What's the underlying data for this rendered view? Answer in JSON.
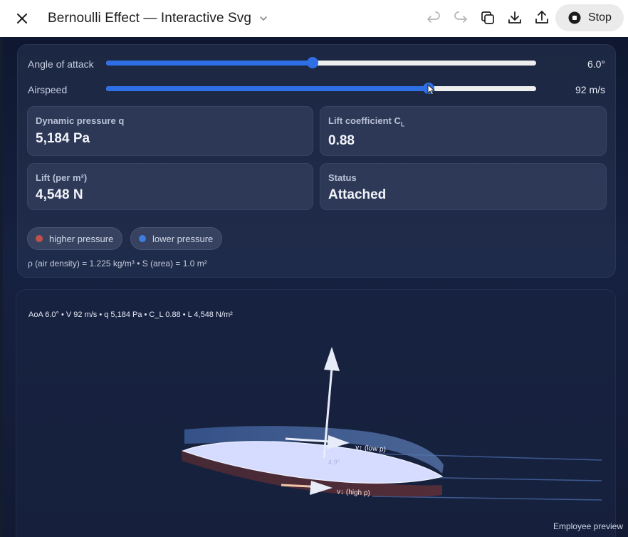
{
  "topbar": {
    "title": "Bernoulli Effect — Interactive Svg",
    "stop_label": "Stop",
    "icons": [
      "close-icon",
      "chevron-down-icon",
      "undo-icon",
      "redo-icon",
      "copy-icon",
      "download-icon",
      "share-icon",
      "stop-icon"
    ]
  },
  "controls": {
    "angle": {
      "label": "Angle of attack",
      "value_text": "6.0°",
      "fraction": 0.48
    },
    "airspeed": {
      "label": "Airspeed",
      "value_text": "92 m/s",
      "fraction": 0.75
    }
  },
  "stats": {
    "dynamic_pressure": {
      "label": "Dynamic pressure q",
      "value": "5,184 Pa"
    },
    "lift_coefficient": {
      "label": "Lift coefficient C",
      "label_sub": "L",
      "value": "0.88"
    },
    "lift": {
      "label": "Lift (per m²)",
      "value": "4,548 N"
    },
    "status": {
      "label": "Status",
      "value": "Attached"
    }
  },
  "legend": {
    "higher": {
      "label": "higher pressure",
      "color": "#c2504a"
    },
    "lower": {
      "label": "lower pressure",
      "color": "#3d7de0"
    }
  },
  "note": "ρ (air density) = 1.225 kg/m³ • S (area) = 1.0 m²",
  "viz": {
    "readout": "AoA 6.0° • V 92 m/s • q 5,184 Pa • C_L 0.88 • L 4,548 N/m²",
    "upper_label": "v↑ (low p)",
    "lower_label": "v↓ (high p)",
    "airfoil_label": "4.9°"
  },
  "watermark": "Employee preview",
  "colors": {
    "accent": "#2f6fe6",
    "airfoil": "#d6dcff",
    "high_pressure": "#c2504a",
    "low_pressure": "#3d7de0"
  }
}
